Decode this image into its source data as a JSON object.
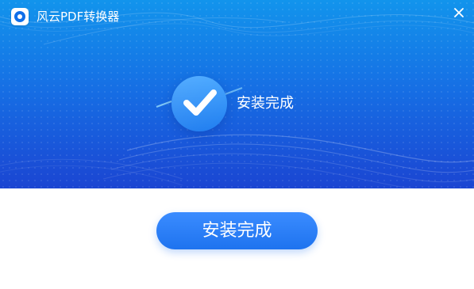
{
  "window": {
    "title": "风云PDF转换器"
  },
  "hero": {
    "status_text": "安装完成"
  },
  "actions": {
    "finish_button_label": "安装完成"
  },
  "icons": {
    "app_logo": "app-logo-icon",
    "close": "close-icon",
    "success": "check-icon"
  },
  "colors": {
    "hero_top": "#1294ec",
    "hero_bottom": "#1b45d2",
    "accent": "#1e73ef",
    "text_light": "#ffffff"
  }
}
